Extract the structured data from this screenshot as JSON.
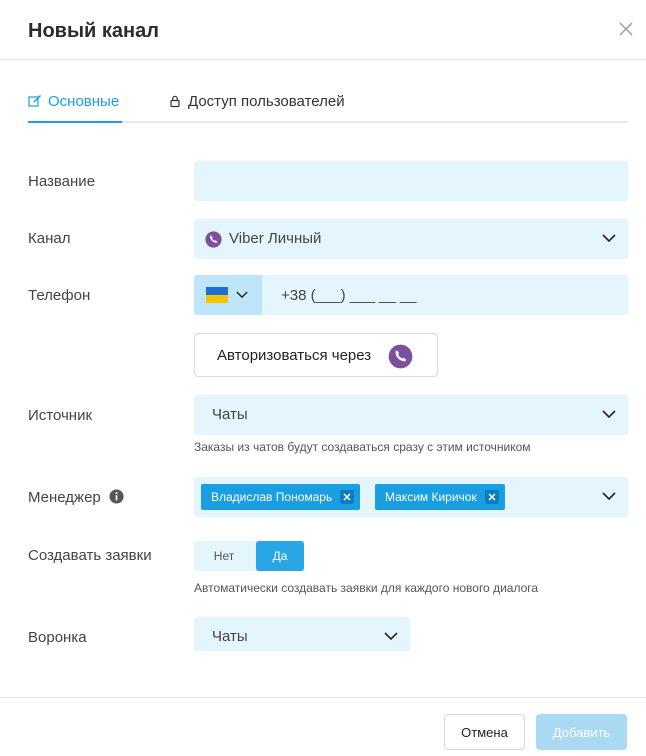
{
  "dialog": {
    "title": "Новый канал"
  },
  "tabs": [
    {
      "label": "Основные",
      "icon": "edit-icon",
      "active": true
    },
    {
      "label": "Доступ пользователей",
      "icon": "lock-icon",
      "active": false
    }
  ],
  "form": {
    "name": {
      "label": "Название",
      "value": ""
    },
    "channel": {
      "label": "Канал",
      "value": "Viber Личный",
      "icon": "viber-icon"
    },
    "phone": {
      "label": "Телефон",
      "country_flag": "ukraine-flag-icon",
      "mask": "+38 (___) ___ __ __"
    },
    "authorize": {
      "label": "Авторизоваться через",
      "icon": "viber-icon"
    },
    "source": {
      "label": "Источник",
      "value": "Чаты",
      "hint": "Заказы из чатов будут создаваться сразу с этим источником"
    },
    "manager": {
      "label": "Менеджер",
      "info_icon": "info-icon",
      "selected": [
        "Владислав Пономарь",
        "Максим Киричок"
      ]
    },
    "create_requests": {
      "label": "Создавать заявки",
      "off_label": "Нет",
      "on_label": "Да",
      "value": "Да",
      "hint": "Автоматически создавать заявки для каждого нового диалога"
    },
    "funnel": {
      "label": "Воронка",
      "value": "Чаты"
    }
  },
  "footer": {
    "cancel_label": "Отмена",
    "submit_label": "Добавить"
  },
  "colors": {
    "accent": "#1b9fe0",
    "field_bg": "#e5f5fd",
    "viber": "#7b519d",
    "chip_bg": "#1a9ee2"
  }
}
